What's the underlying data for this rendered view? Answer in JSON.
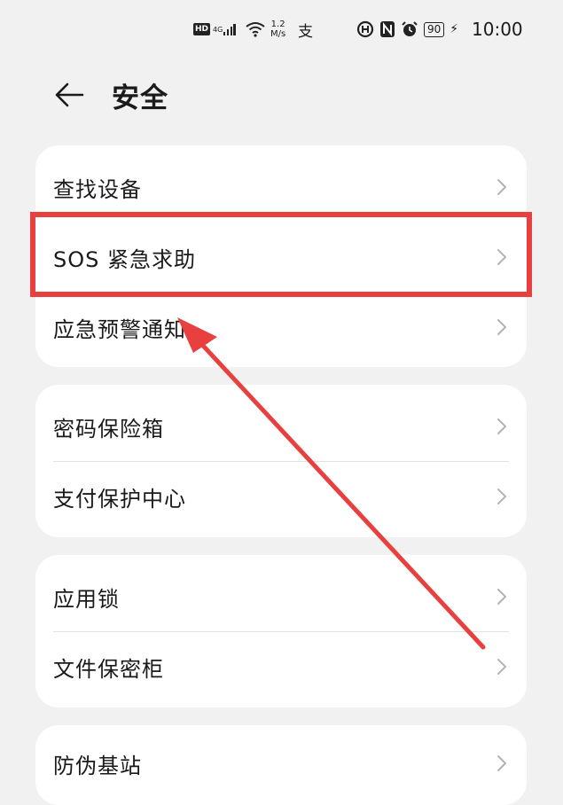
{
  "status_bar": {
    "hd": "HD",
    "network": "4G",
    "speed_value": "1.2",
    "speed_unit": "M/s",
    "pay_icon": "支",
    "battery": "90",
    "time": "10:00",
    "icons": [
      "hd-icon",
      "signal-icon",
      "wifi-icon",
      "alipay-icon",
      "data-saver-icon",
      "nfc-icon",
      "alarm-icon",
      "battery-icon",
      "charging-icon"
    ]
  },
  "header": {
    "title": "安全",
    "back_icon": "arrow-left-icon"
  },
  "groups": [
    {
      "items": [
        {
          "label": "查找设备"
        },
        {
          "label": "SOS 紧急求助"
        },
        {
          "label": "应急预警通知"
        }
      ]
    },
    {
      "items": [
        {
          "label": "密码保险箱"
        },
        {
          "label": "支付保护中心"
        }
      ]
    },
    {
      "items": [
        {
          "label": "应用锁"
        },
        {
          "label": "文件保密柜"
        }
      ]
    },
    {
      "items": [
        {
          "label": "防伪基站"
        }
      ]
    }
  ],
  "annotation": {
    "highlight_color": "#e8403f",
    "highlighted_item": "SOS 紧急求助"
  }
}
